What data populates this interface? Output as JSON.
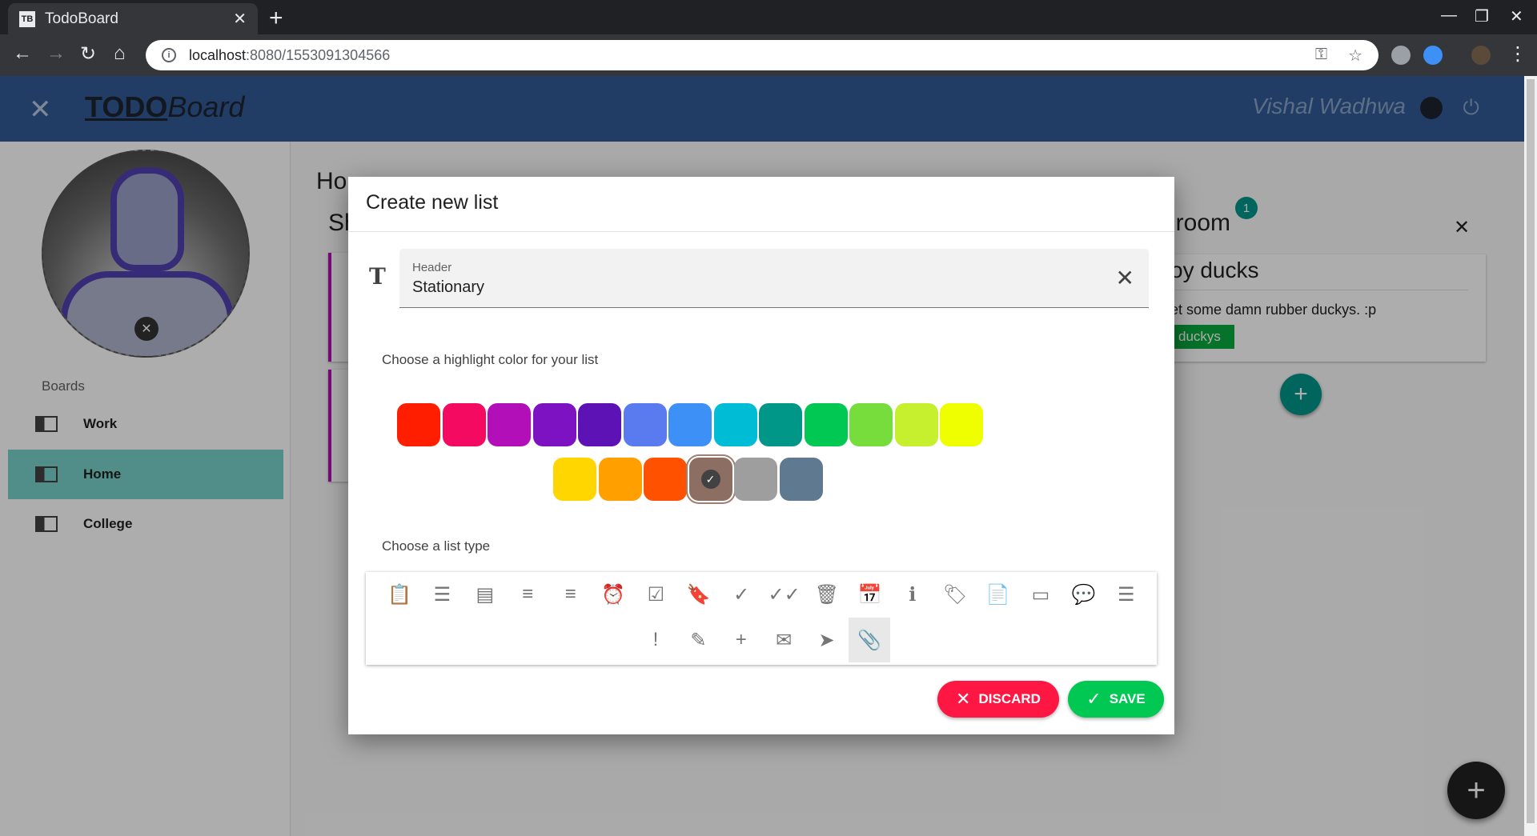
{
  "browser": {
    "tab_title": "TodoBoard",
    "tab_favicon": "TB",
    "url_host": "localhost",
    "url_path": ":8080/1553091304566"
  },
  "app": {
    "logo_todo": "TODO",
    "logo_board": "Board",
    "user_name": "Vishal Wadhwa"
  },
  "sidebar": {
    "boards_label": "Boards",
    "boards": [
      {
        "label": "Work",
        "active": false
      },
      {
        "label": "Home",
        "active": true
      },
      {
        "label": "College",
        "active": false
      }
    ]
  },
  "board": {
    "title_partial": "Ho",
    "list1_title_partial": "Sh",
    "list2_title_partial": "nroom",
    "list2_badge": "1",
    "card_title_partial": "oy ducks",
    "card_desc_partial": "et some damn rubber duckys. :p",
    "card_tag": "duckys"
  },
  "dialog": {
    "title": "Create new list",
    "header_label": "Header",
    "header_value": "Stationary",
    "color_prompt": "Choose a highlight color for your list",
    "colors_row1": [
      "#ff1f00",
      "#f50a62",
      "#b30fb8",
      "#7d12c2",
      "#5c12b5",
      "#5a7af0",
      "#3d90f5",
      "#00bcd4",
      "#009688",
      "#00c853",
      "#76dd3d",
      "#c6ef2e",
      "#f0ff00"
    ],
    "colors_row2": [
      "#ffd600",
      "#ffa000",
      "#ff5100",
      "#8d6e63",
      "#9e9e9e",
      "#5f7a90"
    ],
    "selected_color": "#8d6e63",
    "type_prompt": "Choose a list type",
    "list_types_row1": [
      "assignment-icon",
      "list-icon",
      "view-list-icon",
      "playlist-check-icon",
      "playlist-play-icon",
      "alarm-icon",
      "assignment-turned-in-icon",
      "bookmark-icon",
      "check-icon",
      "done-all-icon",
      "delete-icon",
      "event-icon",
      "info-icon",
      "label-icon",
      "note-add-icon",
      "credit-card-icon",
      "forum-icon",
      "subject-icon"
    ],
    "list_types_row2": [
      "error-icon",
      "edit-icon",
      "add-icon",
      "email-icon",
      "send-icon",
      "attach-file-icon"
    ],
    "selected_type": "attach-file-icon",
    "discard_label": "DISCARD",
    "save_label": "SAVE"
  }
}
